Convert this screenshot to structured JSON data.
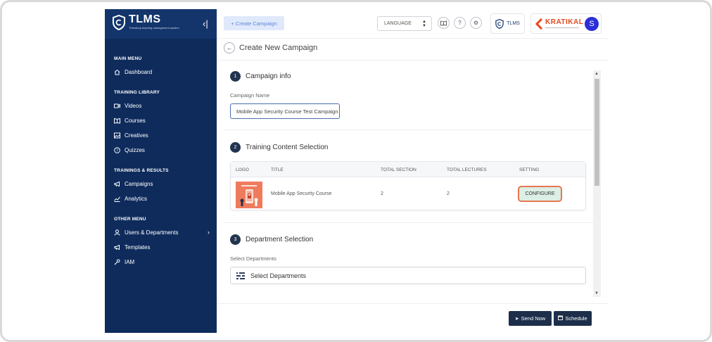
{
  "app": {
    "name": "TLMS",
    "tagline": "Threatcop learning management system"
  },
  "sidebar": {
    "collapse_icon": "collapse-sidebar-icon",
    "sections": [
      {
        "title": "MAIN MENU",
        "items": [
          {
            "label": "Dashboard",
            "icon": "home-icon"
          }
        ]
      },
      {
        "title": "TRAINING LIBRARY",
        "items": [
          {
            "label": "Videos",
            "icon": "video-icon"
          },
          {
            "label": "Courses",
            "icon": "book-icon"
          },
          {
            "label": "Creatives",
            "icon": "image-icon"
          },
          {
            "label": "Quizzes",
            "icon": "question-icon"
          }
        ]
      },
      {
        "title": "TRAININGS & RESULTS",
        "items": [
          {
            "label": "Campaigns",
            "icon": "megaphone-icon"
          },
          {
            "label": "Analytics",
            "icon": "chart-line-icon"
          }
        ]
      },
      {
        "title": "OTHER MENU",
        "items": [
          {
            "label": "Users & Departments",
            "icon": "user-icon"
          },
          {
            "label": "Templates",
            "icon": "megaphone-icon"
          },
          {
            "label": "IAM",
            "icon": "key-icon"
          }
        ]
      }
    ]
  },
  "topbar": {
    "create_campaign": "+ Create Campaign",
    "language_select": "LANGUAGE",
    "tlms_badge": "TLMS",
    "brand_name": "KRATIKAL",
    "avatar_initial": "S"
  },
  "page": {
    "title": "Create New Campaign",
    "steps": [
      {
        "number": "1",
        "title": "Campaign info"
      },
      {
        "number": "2",
        "title": "Training Content Selection"
      },
      {
        "number": "3",
        "title": "Department Selection"
      }
    ],
    "campaign_name_label": "Campaign Name",
    "campaign_name_value": "Mobile App Security Course Test Campaign",
    "content_table": {
      "headers": [
        "LOGO",
        "TITLE",
        "TOTAL SECTION",
        "TOTAL LECTURES",
        "SETTING"
      ],
      "row": {
        "title": "Mobile App Security Course",
        "total_section": "2",
        "total_lectures": "2",
        "setting_button": "CONFIGURE"
      }
    },
    "department_label": "Select Departments",
    "department_placeholder": "Select Departments"
  },
  "footer": {
    "send_now": "Send Now",
    "schedule": "Schedule"
  },
  "colors": {
    "sidebar_bg": "#0e2b5c",
    "primary_dark": "#1c2e4a",
    "highlight_border": "#e8774f",
    "brand_orange": "#e5481d",
    "avatar_blue": "#2b2fd9"
  }
}
